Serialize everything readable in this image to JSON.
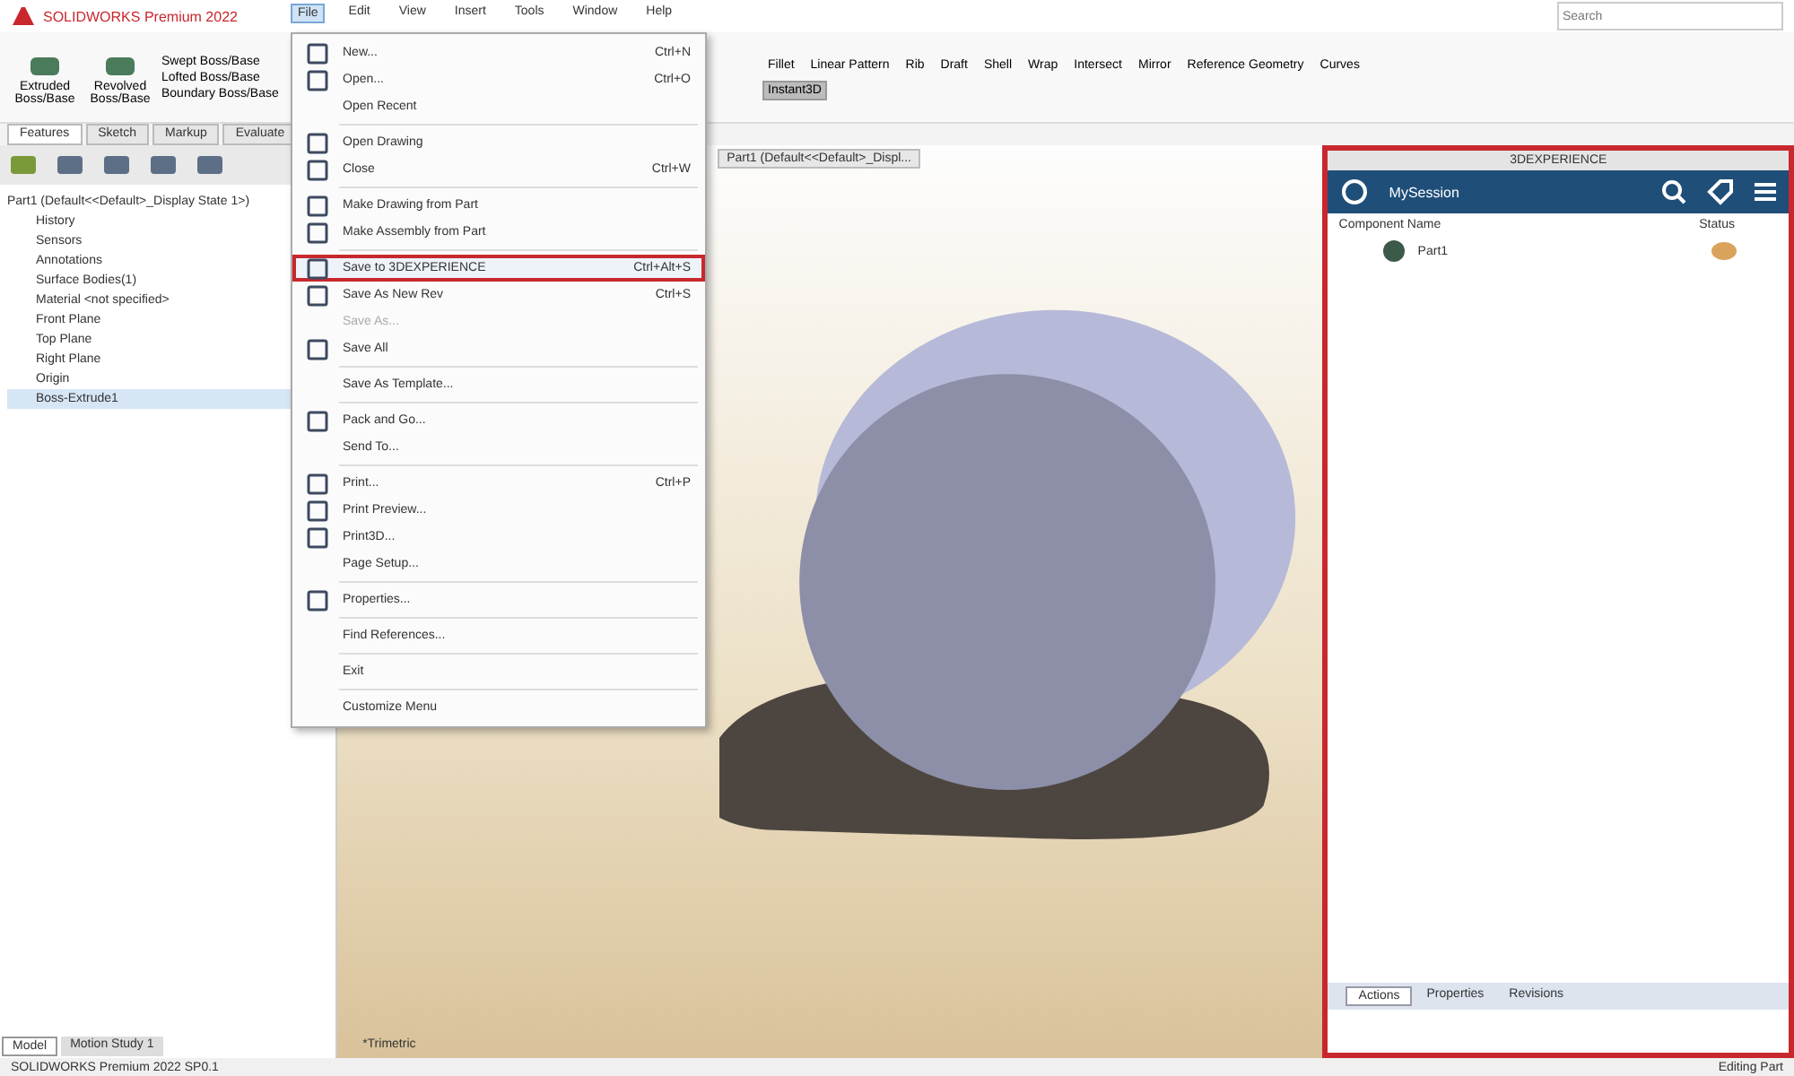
{
  "app_title": "SOLIDWORKS Premium 2022",
  "menu_bar": [
    {
      "label": "File",
      "selected": true
    },
    {
      "label": "Edit",
      "selected": false
    },
    {
      "label": "View",
      "selected": false
    },
    {
      "label": "Insert",
      "selected": false
    },
    {
      "label": "Tools",
      "selected": false
    },
    {
      "label": "Window",
      "selected": false
    },
    {
      "label": "Help",
      "selected": false
    }
  ],
  "search_placeholder": "Search",
  "ribbon_left": [
    "Extruded Boss/Base",
    "Revolved Boss/Base"
  ],
  "ribbon_small": [
    "Swept Boss/Base",
    "Lofted Boss/Base",
    "Boundary Boss/Base"
  ],
  "ribbon_right": [
    {
      "label": "Fillet",
      "selected": false
    },
    {
      "label": "Linear Pattern",
      "selected": false
    },
    {
      "label": "Rib",
      "selected": false
    },
    {
      "label": "Draft",
      "selected": false
    },
    {
      "label": "Shell",
      "selected": false
    },
    {
      "label": "Wrap",
      "selected": false
    },
    {
      "label": "Intersect",
      "selected": false
    },
    {
      "label": "Mirror",
      "selected": false
    },
    {
      "label": "Reference Geometry",
      "selected": false
    },
    {
      "label": "Curves",
      "selected": false
    },
    {
      "label": "Instant3D",
      "selected": true
    }
  ],
  "command_tabs": [
    {
      "label": "Features",
      "selected": true
    },
    {
      "label": "Sketch",
      "selected": false
    },
    {
      "label": "Markup",
      "selected": false
    },
    {
      "label": "Evaluate",
      "selected": false
    }
  ],
  "tree": [
    {
      "label": "Part1 (Default<<Default>_Display State 1>)",
      "children": [
        {
          "label": "History"
        },
        {
          "label": "Sensors"
        },
        {
          "label": "Annotations"
        },
        {
          "label": "Surface Bodies(1)"
        },
        {
          "label": "Material <not specified>"
        },
        {
          "label": "Front Plane"
        },
        {
          "label": "Top Plane"
        },
        {
          "label": "Right Plane"
        },
        {
          "label": "Origin"
        },
        {
          "label": "Boss-Extrude1",
          "selected": true
        }
      ]
    }
  ],
  "file_menu": [
    [
      {
        "label": "New...",
        "shortcut": "Ctrl+N",
        "icon": true
      },
      {
        "label": "Open...",
        "shortcut": "Ctrl+O",
        "icon": true
      },
      {
        "label": "Open Recent",
        "icon": false
      }
    ],
    [
      {
        "label": "Open Drawing",
        "icon": true
      },
      {
        "label": "Close",
        "shortcut": "Ctrl+W",
        "icon": true
      }
    ],
    [
      {
        "label": "Make Drawing from Part",
        "icon": true
      },
      {
        "label": "Make Assembly from Part",
        "icon": true
      }
    ],
    [
      {
        "label": "Save to 3DEXPERIENCE",
        "shortcut": "Ctrl+Alt+S",
        "icon": true,
        "highlighted": true
      },
      {
        "label": "Save As New Rev",
        "shortcut": "Ctrl+S",
        "icon": true
      },
      {
        "label": "Save As...",
        "icon": false,
        "disabled": true
      },
      {
        "label": "Save All",
        "icon": true
      }
    ],
    [
      {
        "label": "Save As Template...",
        "icon": false
      }
    ],
    [
      {
        "label": "Pack and Go...",
        "icon": true
      },
      {
        "label": "Send To...",
        "icon": false
      }
    ],
    [
      {
        "label": "Print...",
        "shortcut": "Ctrl+P",
        "icon": true
      },
      {
        "label": "Print Preview...",
        "icon": true
      },
      {
        "label": "Print3D...",
        "icon": true
      },
      {
        "label": "Page Setup...",
        "icon": false
      }
    ],
    [
      {
        "label": "Properties...",
        "icon": true
      }
    ],
    [
      {
        "label": "Find References...",
        "icon": false
      }
    ],
    [
      {
        "label": "Exit",
        "icon": false
      }
    ],
    [
      {
        "label": "Customize Menu",
        "icon": false
      }
    ]
  ],
  "doc_tab": "Part1 (Default<<Default>_Displ...",
  "view_label": "*Trimetric",
  "bottom_tabs": [
    {
      "label": "Model",
      "selected": true
    },
    {
      "label": "Motion Study 1",
      "selected": false
    }
  ],
  "status_left": "SOLIDWORKS Premium 2022 SP0.1",
  "status_right": "Editing Part",
  "task_pane": {
    "title": "3DEXPERIENCE",
    "session": "MySession",
    "columns": [
      "Component Name",
      "Status"
    ],
    "rows": [
      {
        "name": "Part1"
      }
    ],
    "tabs": [
      {
        "label": "Actions",
        "selected": true
      },
      {
        "label": "Properties",
        "selected": false
      },
      {
        "label": "Revisions",
        "selected": false
      }
    ]
  }
}
